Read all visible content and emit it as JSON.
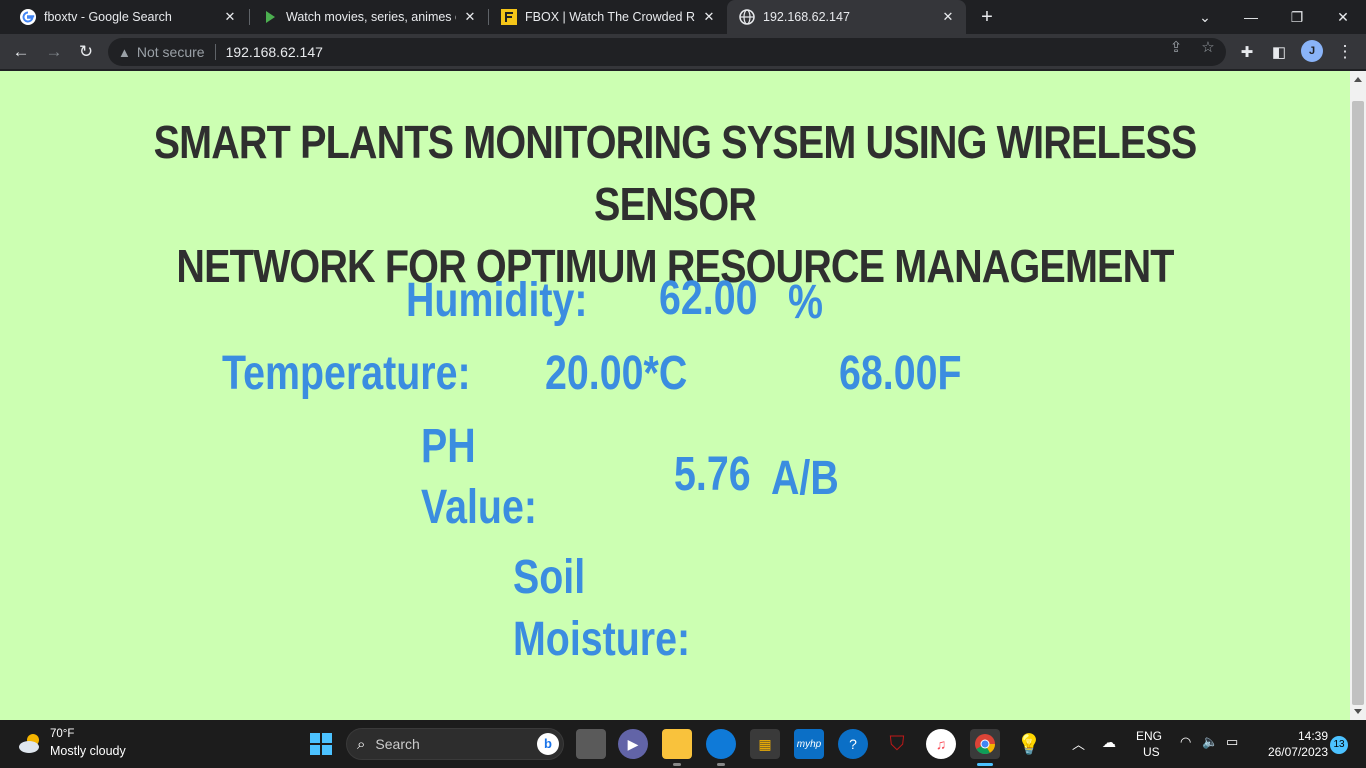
{
  "browser": {
    "tabs": [
      {
        "title": "fboxtv - Google Search",
        "favicon": "google-icon",
        "active": false
      },
      {
        "title": "Watch movies, series, animes onl",
        "favicon": "play-icon",
        "active": false
      },
      {
        "title": "FBOX | Watch The Crowded Room",
        "favicon": "fbox-icon",
        "active": false
      },
      {
        "title": "192.168.62.147",
        "favicon": "globe-icon",
        "active": true
      }
    ],
    "security_label": "Not secure",
    "url": "192.168.62.147",
    "profile_initial": "J"
  },
  "page": {
    "title_line1": "SMART PLANTS MONITORING SYSEM USING WIRELESS SENSOR",
    "title_line2": "NETWORK FOR OPTIMUM RESOURCE MANAGEMENT",
    "humidity_label": "Humidity:",
    "humidity_value": "62.00",
    "humidity_unit": "%",
    "temperature_label": "Temperature:",
    "temperature_c": "20.00*C",
    "temperature_f": "68.00F",
    "ph_label_line1": "PH",
    "ph_label_line2": "Value:",
    "ph_value": "5.76",
    "ph_unit": "A/B",
    "soil_label_line1": "Soil",
    "soil_label_line2": "Moisture:",
    "colors": {
      "background": "#ccffb2",
      "title": "#2f2f2f",
      "labels": "#3b8de0"
    }
  },
  "taskbar": {
    "weather_temp": "70°F",
    "weather_desc": "Mostly cloudy",
    "search_placeholder": "Search",
    "lang_line1": "ENG",
    "lang_line2": "US",
    "time": "14:39",
    "date": "26/07/2023",
    "notification_count": "13"
  }
}
